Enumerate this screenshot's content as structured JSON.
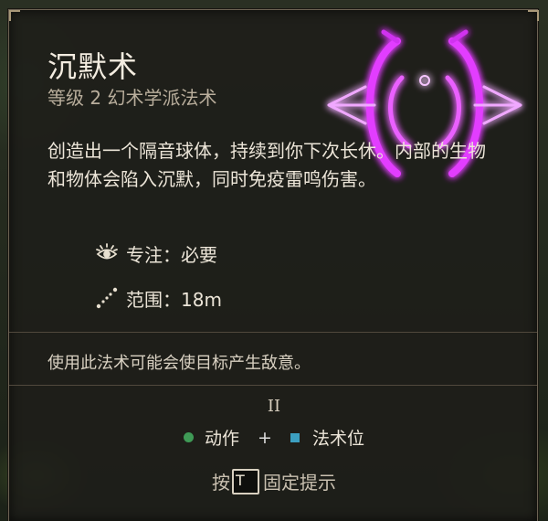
{
  "spell": {
    "name": "沉默术",
    "subtitle": "等级 2 幻术学派法术",
    "description": "创造出一个隔音球体，持续到你下次长休。内部的生物和物体会陷入沉默，同时免疫雷鸣伤害。",
    "concentration": "专注：必要",
    "range": "范围：18m",
    "warning": "使用此法术可能会使目标产生敌意。",
    "level_roman": "II",
    "cost_action": "动作",
    "cost_plus": "+",
    "cost_slot": "法术位",
    "pin_prefix": "按",
    "pin_key": "T",
    "pin_suffix": "固定提示"
  },
  "icons": {
    "spell_art": "silence-spell-icon",
    "concentration": "concentration-eye-icon",
    "range": "range-dotted-line-icon",
    "action": "action-green-dot-icon",
    "slot": "spell-slot-blue-square-icon"
  },
  "colors": {
    "spell_glow": "#e23cff",
    "action": "#3f9a56",
    "spell_slot": "#3c9fc0"
  }
}
